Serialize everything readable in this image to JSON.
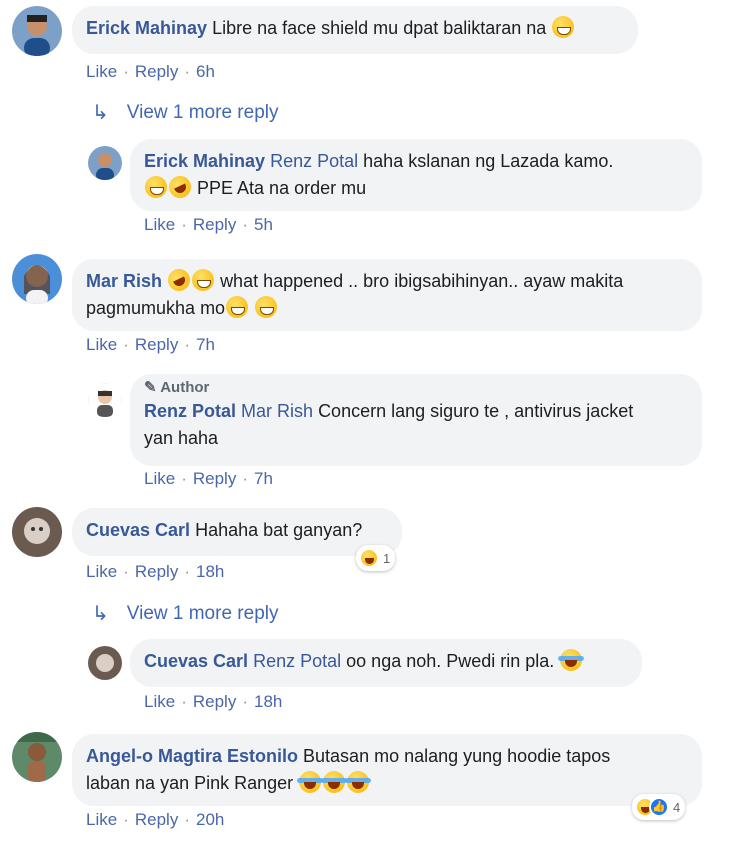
{
  "common": {
    "like": "Like",
    "reply": "Reply",
    "dot": "·",
    "author": "Author"
  },
  "comments": [
    {
      "name": "Erick Mahinay",
      "text": "Libre na face shield mu dpat baliktaran na",
      "time": "6h"
    },
    {
      "more": "View 1 more reply"
    },
    {
      "name": "Erick Mahinay",
      "tag": "Renz Potal",
      "text": "haha kslanan ng Lazada kamo.",
      "text2": "PPE Ata na order mu",
      "time": "5h"
    },
    {
      "name": "Mar Rish",
      "text": "what happened .. bro ibigsabihinyan.. ayaw makita",
      "text2": "pagmumukha mo",
      "time": "7h"
    },
    {
      "name": "Renz Potal",
      "tag": "Mar Rish",
      "text": "Concern lang siguro te , antivirus jacket",
      "text2": "yan haha",
      "time": "7h"
    },
    {
      "name": "Cuevas Carl",
      "text": "Hahaha bat ganyan?",
      "time": "18h",
      "reactions": "1"
    },
    {
      "more": "View 1 more reply"
    },
    {
      "name": "Cuevas Carl",
      "tag": "Renz Potal",
      "text": "oo nga noh. Pwedi rin pla.",
      "time": "18h"
    },
    {
      "name": "Angel-o Magtira Estonilo",
      "text": "Butasan mo nalang yung hoodie tapos",
      "text2": "laban na yan Pink Ranger",
      "time": "20h",
      "reactions": "4"
    }
  ],
  "icons": {
    "reply_arrow": "reply-arrow-icon",
    "pencil": "pencil-icon"
  }
}
